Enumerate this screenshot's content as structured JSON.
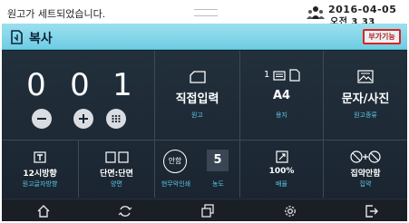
{
  "status": {
    "message": "원고가 세트되었습니다.",
    "date": "2016-04-05",
    "time": "오전 3 33"
  },
  "title_bar": {
    "title": "복사",
    "extra_button": "부가기능"
  },
  "copy_count": {
    "digits": [
      "0",
      "0",
      "1"
    ]
  },
  "settings": {
    "original_input": {
      "value": "직접입력",
      "label": "원고"
    },
    "paper": {
      "count": "1",
      "value": "A4",
      "label": "용지"
    },
    "original_type": {
      "value": "문자/사진",
      "label": "원고종류"
    },
    "orientation": {
      "value": "12시방향",
      "label": "원고글자방향"
    },
    "duplex": {
      "value": "단면:단면",
      "label": "양면"
    },
    "stamp": {
      "icon_text": "안함",
      "label": "현무악인쇄"
    },
    "density": {
      "value": "5",
      "label": "농도"
    },
    "zoom": {
      "value": "100%",
      "label": "배율"
    },
    "nup": {
      "value": "집약안함",
      "label": "집약"
    }
  },
  "icons": {
    "user": "user-group-icon",
    "copy": "copy-document-icon",
    "nav": [
      "home-icon",
      "reset-icon",
      "job-list-icon",
      "settings-gear-icon",
      "exit-icon"
    ]
  },
  "colors": {
    "title_bar": "#7dd3e8",
    "panel": "#1e2b37",
    "accent_label": "#5ec9e6",
    "highlight_border": "#e02020"
  }
}
